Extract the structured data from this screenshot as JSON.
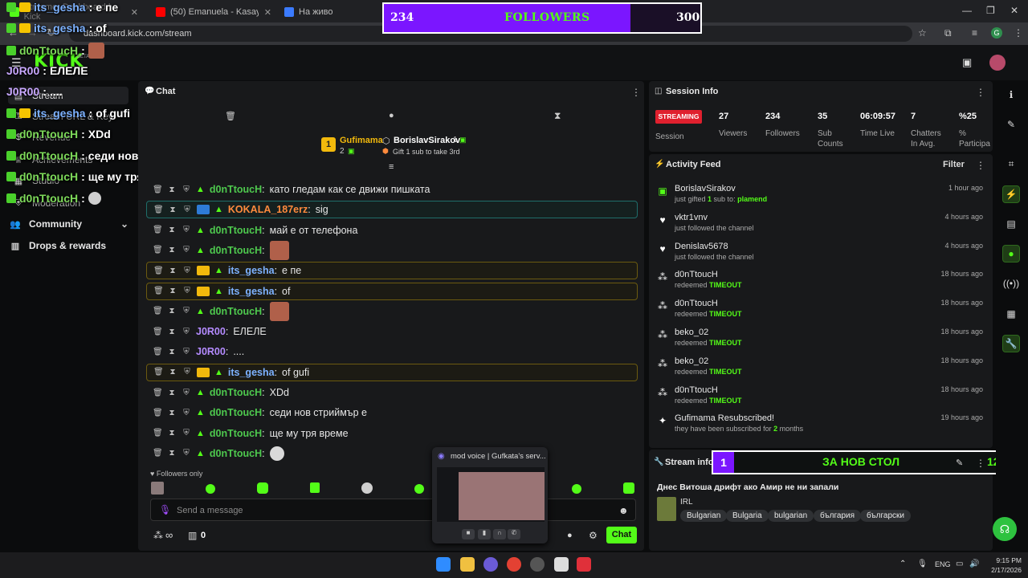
{
  "browser": {
    "tabs": [
      {
        "title": "Streamer Dashboard | Kick",
        "color": "#53fc18"
      },
      {
        "title": "(50) Emanuela - Kasay / Емануела",
        "color": "#ff0000"
      },
      {
        "title": "На живо",
        "color": "#3b7bff"
      }
    ],
    "url": "dashboard.kick.com/stream",
    "profile_initial": "G"
  },
  "followers_goal": {
    "current": "234",
    "label": "FOLLOWERS",
    "goal": "300",
    "progress_fraction": 0.78
  },
  "kick": {
    "logo": "KICK",
    "beta": "BETA"
  },
  "sidebar": {
    "items": [
      {
        "icon": "stream-icon",
        "label": "Stream"
      },
      {
        "icon": "stream-url-icon",
        "label": "Stream URL & Key"
      },
      {
        "icon": "revenue-icon",
        "label": "Revenue"
      },
      {
        "icon": "achievements-icon",
        "label": "Achievements"
      },
      {
        "icon": "studio-icon",
        "label": "Studio"
      },
      {
        "icon": "moderation-icon",
        "label": "Moderation"
      },
      {
        "icon": "community-icon",
        "label": "Community"
      },
      {
        "icon": "drops-icon",
        "label": "Drops & rewards"
      }
    ]
  },
  "overlay_chat": [
    {
      "user": "its_gesha",
      "sep": ":",
      "msg": "е пе",
      "color": "blue",
      "badge": "crown"
    },
    {
      "user": "its_gesha",
      "sep": ":",
      "msg": "of",
      "color": "blue",
      "badge": "crown"
    },
    {
      "user": "d0nTtoucH",
      "sep": ":",
      "msg": "",
      "color": "green",
      "emote": true
    },
    {
      "user": "J0R00",
      "sep": ":",
      "msg": "ЕЛЕЛЕ",
      "color": "purple"
    },
    {
      "user": "J0R00",
      "sep": ":",
      "msg": "....",
      "color": "purple"
    },
    {
      "user": "its_gesha",
      "sep": ":",
      "msg": "of gufi",
      "color": "blue",
      "badge": "crown"
    },
    {
      "user": "d0nTtoucH",
      "sep": ":",
      "msg": "XDd",
      "color": "green"
    },
    {
      "user": "d0nTtoucH",
      "sep": ":",
      "msg": "седи нов стриймър е",
      "color": "green"
    },
    {
      "user": "d0nTtoucH",
      "sep": ":",
      "msg": "ще му тря време",
      "color": "green"
    },
    {
      "user": "d0nTtoucH",
      "sep": ":",
      "msg": "",
      "color": "green",
      "face": true
    }
  ],
  "chat": {
    "title": "Chat",
    "pinned": {
      "left_rank": "1",
      "left_user": "Gufimama",
      "left_count": "2",
      "right_user": "BorislavSirakov",
      "right_count": "1",
      "right_note": "Gift 1 sub to take 3rd"
    },
    "messages": [
      {
        "user": "d0nTtoucH",
        "msg": "като гледам как се движи пишката",
        "color": "green",
        "hl": ""
      },
      {
        "user": "KOKALA_187erz",
        "msg": "sig",
        "color": "orange",
        "hl": "teal"
      },
      {
        "user": "d0nTtoucH",
        "msg": "май е от телефона",
        "color": "green",
        "hl": ""
      },
      {
        "user": "d0nTtoucH",
        "msg": "",
        "color": "green",
        "hl": "",
        "emote": true
      },
      {
        "user": "its_gesha",
        "msg": "е пе",
        "color": "blue",
        "hl": "gold"
      },
      {
        "user": "its_gesha",
        "msg": "of",
        "color": "blue",
        "hl": "gold"
      },
      {
        "user": "d0nTtoucH",
        "msg": "",
        "color": "green",
        "hl": "",
        "emote": true
      },
      {
        "user": "J0R00",
        "msg": "ЕЛЕЛЕ",
        "color": "purple",
        "hl": ""
      },
      {
        "user": "J0R00",
        "msg": "....",
        "color": "purple",
        "hl": ""
      },
      {
        "user": "its_gesha",
        "msg": "of gufi",
        "color": "blue",
        "hl": "gold"
      },
      {
        "user": "d0nTtoucH",
        "msg": "XDd",
        "color": "green",
        "hl": ""
      },
      {
        "user": "d0nTtoucH",
        "msg": "седи нов стриймър е",
        "color": "green",
        "hl": ""
      },
      {
        "user": "d0nTtoucH",
        "msg": "ще му тря време",
        "color": "green",
        "hl": ""
      },
      {
        "user": "d0nTtoucH",
        "msg": "",
        "color": "green",
        "hl": "",
        "face": true
      }
    ],
    "followers_only": "Followers only",
    "input_placeholder": "Send a message",
    "infinity": "∞",
    "gifts": "0",
    "chat_button": "Chat"
  },
  "popup": {
    "title": "mod voice | Gufkata's serv..."
  },
  "session": {
    "title": "Session Info",
    "status": "STREAMING",
    "status_label": "Session",
    "stats": [
      {
        "value": "27",
        "label": "Viewers"
      },
      {
        "value": "234",
        "label": "Followers"
      },
      {
        "value": "35",
        "label": "Sub Counts"
      },
      {
        "value": "06:09:57",
        "label": "Time Live"
      },
      {
        "value": "7",
        "label": "Chatters In Avg."
      },
      {
        "value": "%25",
        "label": "% Participa"
      }
    ]
  },
  "activity": {
    "title": "Activity Feed",
    "filter": "Filter",
    "items": [
      {
        "icon": "gift-icon",
        "name": "BorislavSirakov",
        "desc_pre": "just gifted ",
        "desc_hl": "1",
        "desc_post": " sub to: ",
        "desc_hl2": "plamend",
        "time": "1 hour ago"
      },
      {
        "icon": "heart-icon",
        "name": "vktr1vnv",
        "desc_pre": "just followed the channel",
        "desc_hl": "",
        "desc_post": "",
        "desc_hl2": "",
        "time": "4 hours ago"
      },
      {
        "icon": "heart-icon",
        "name": "Denislav5678",
        "desc_pre": "just followed the channel",
        "desc_hl": "",
        "desc_post": "",
        "desc_hl2": "",
        "time": "4 hours ago"
      },
      {
        "icon": "redeem-icon",
        "name": "d0nTtoucH",
        "desc_pre": "redeemed ",
        "desc_hl": "TIMEOUT",
        "desc_post": "",
        "desc_hl2": "",
        "time": "18 hours ago"
      },
      {
        "icon": "redeem-icon",
        "name": "d0nTtoucH",
        "desc_pre": "redeemed ",
        "desc_hl": "TIMEOUT",
        "desc_post": "",
        "desc_hl2": "",
        "time": "18 hours ago"
      },
      {
        "icon": "redeem-icon",
        "name": "beko_02",
        "desc_pre": "redeemed ",
        "desc_hl": "TIMEOUT",
        "desc_post": "",
        "desc_hl2": "",
        "time": "18 hours ago"
      },
      {
        "icon": "redeem-icon",
        "name": "beko_02",
        "desc_pre": "redeemed ",
        "desc_hl": "TIMEOUT",
        "desc_post": "",
        "desc_hl2": "",
        "time": "18 hours ago"
      },
      {
        "icon": "redeem-icon",
        "name": "d0nTtoucH",
        "desc_pre": "redeemed ",
        "desc_hl": "TIMEOUT",
        "desc_post": "",
        "desc_hl2": "",
        "time": "18 hours ago"
      },
      {
        "icon": "sparkle-icon",
        "name": "Gufimama Resubscribed!",
        "desc_pre": "they have been subscribed for ",
        "desc_hl": "2",
        "desc_post": " months",
        "desc_hl2": "",
        "time": "19 hours ago"
      }
    ]
  },
  "stream_info": {
    "title": "Stream info",
    "banner_left": "1",
    "banner_text": "ЗА НОВ СТОЛ",
    "banner_right": "12",
    "stream_title": "Днес Витоша дрифт ако Амир не ни запали",
    "category": "IRL",
    "tags": [
      "Bulgarian",
      "Bulgaria",
      "bulgarian",
      "българия",
      "български"
    ]
  },
  "taskbar": {
    "lang": "ENG",
    "time": "9:15 PM",
    "date": "2/17/2026"
  },
  "colors": {
    "kick_green": "#53fc18",
    "purple": "#7b16ff"
  }
}
